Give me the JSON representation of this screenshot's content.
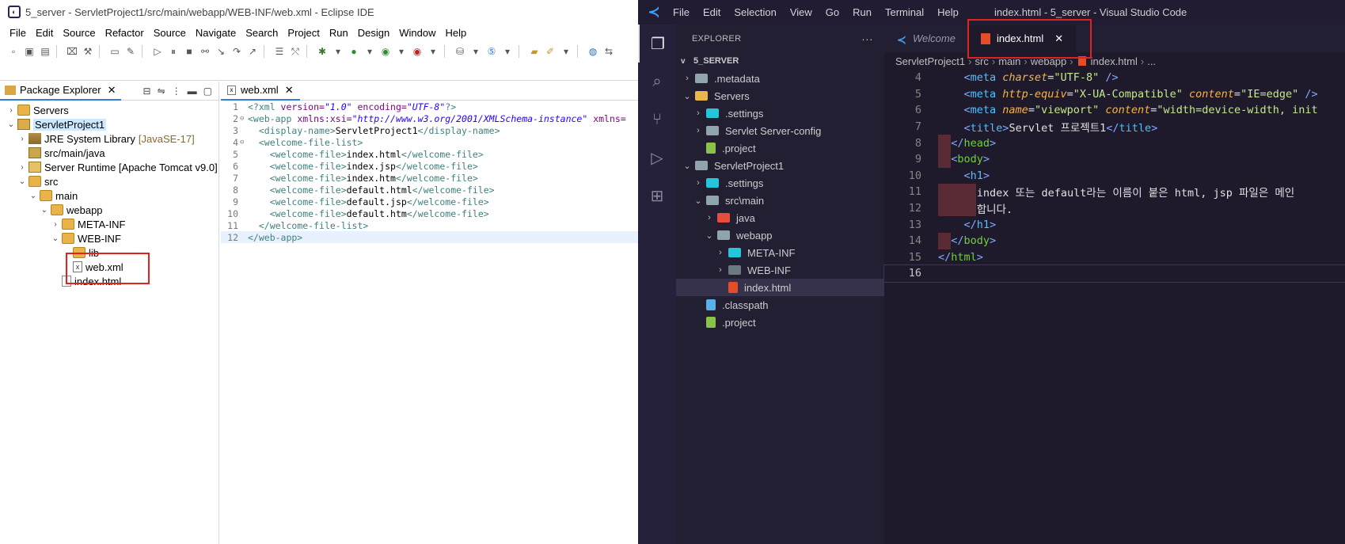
{
  "eclipse": {
    "title": "5_server - ServletProject1/src/main/webapp/WEB-INF/web.xml - Eclipse IDE",
    "menu": [
      "File",
      "Edit",
      "Source",
      "Refactor",
      "Source",
      "Navigate",
      "Search",
      "Project",
      "Run",
      "Design",
      "Window",
      "Help"
    ],
    "package_explorer": {
      "tab_label": "Package Explorer",
      "tree": [
        {
          "label": "Servers",
          "depth": 0,
          "twisty": ">",
          "icon": "folder"
        },
        {
          "label": "ServletProject1",
          "depth": 0,
          "twisty": "v",
          "icon": "project",
          "selected": true
        },
        {
          "label": "JRE System Library",
          "suffix": "[JavaSE-17]",
          "depth": 1,
          "twisty": ">",
          "icon": "jar"
        },
        {
          "label": "src/main/java",
          "depth": 1,
          "twisty": "",
          "icon": "package"
        },
        {
          "label": "Server Runtime [Apache Tomcat v9.0]",
          "depth": 1,
          "twisty": ">",
          "icon": "server"
        },
        {
          "label": "src",
          "depth": 1,
          "twisty": "v",
          "icon": "folder"
        },
        {
          "label": "main",
          "depth": 2,
          "twisty": "v",
          "icon": "folder"
        },
        {
          "label": "webapp",
          "depth": 3,
          "twisty": "v",
          "icon": "folder"
        },
        {
          "label": "META-INF",
          "depth": 4,
          "twisty": ">",
          "icon": "folder"
        },
        {
          "label": "WEB-INF",
          "depth": 4,
          "twisty": "v",
          "icon": "folder"
        },
        {
          "label": "lib",
          "depth": 5,
          "twisty": "",
          "icon": "folder"
        },
        {
          "label": "web.xml",
          "depth": 5,
          "twisty": "",
          "icon": "xml"
        },
        {
          "label": "index.html",
          "depth": 4,
          "twisty": "",
          "icon": "file"
        }
      ]
    },
    "editor": {
      "tab_label": "web.xml",
      "lines": [
        {
          "n": "1",
          "fold": "",
          "tokens": [
            [
              "x-tag",
              "<?xml "
            ],
            [
              "x-attr",
              "version="
            ],
            [
              "x-val",
              "\"1.0\""
            ],
            [
              "x-attr",
              " encoding="
            ],
            [
              "x-val",
              "\"UTF-8\""
            ],
            [
              "x-tag",
              "?>"
            ]
          ]
        },
        {
          "n": "2",
          "fold": "⊖",
          "tokens": [
            [
              "x-tag",
              "<web-app "
            ],
            [
              "x-attr",
              "xmlns:xsi="
            ],
            [
              "x-val",
              "\"http://www.w3.org/2001/XMLSchema-instance\""
            ],
            [
              "x-attr",
              " xmlns="
            ]
          ]
        },
        {
          "n": "3",
          "fold": "",
          "tokens": [
            [
              "x-txt",
              "  "
            ],
            [
              "x-tag",
              "<display-name>"
            ],
            [
              "x-txt",
              "ServletProject1"
            ],
            [
              "x-tag",
              "</display-name>"
            ]
          ]
        },
        {
          "n": "4",
          "fold": "⊖",
          "tokens": [
            [
              "x-txt",
              "  "
            ],
            [
              "x-tag",
              "<welcome-file-list>"
            ]
          ]
        },
        {
          "n": "5",
          "fold": "",
          "tokens": [
            [
              "x-txt",
              "    "
            ],
            [
              "x-tag",
              "<welcome-file>"
            ],
            [
              "x-txt",
              "index.html"
            ],
            [
              "x-tag",
              "</welcome-file>"
            ]
          ]
        },
        {
          "n": "6",
          "fold": "",
          "tokens": [
            [
              "x-txt",
              "    "
            ],
            [
              "x-tag",
              "<welcome-file>"
            ],
            [
              "x-txt",
              "index.jsp"
            ],
            [
              "x-tag",
              "</welcome-file>"
            ]
          ]
        },
        {
          "n": "7",
          "fold": "",
          "tokens": [
            [
              "x-txt",
              "    "
            ],
            [
              "x-tag",
              "<welcome-file>"
            ],
            [
              "x-txt",
              "index.htm"
            ],
            [
              "x-tag",
              "</welcome-file>"
            ]
          ]
        },
        {
          "n": "8",
          "fold": "",
          "tokens": [
            [
              "x-txt",
              "    "
            ],
            [
              "x-tag",
              "<welcome-file>"
            ],
            [
              "x-txt",
              "default.html"
            ],
            [
              "x-tag",
              "</welcome-file>"
            ]
          ]
        },
        {
          "n": "9",
          "fold": "",
          "tokens": [
            [
              "x-txt",
              "    "
            ],
            [
              "x-tag",
              "<welcome-file>"
            ],
            [
              "x-txt",
              "default.jsp"
            ],
            [
              "x-tag",
              "</welcome-file>"
            ]
          ]
        },
        {
          "n": "10",
          "fold": "",
          "tokens": [
            [
              "x-txt",
              "    "
            ],
            [
              "x-tag",
              "<welcome-file>"
            ],
            [
              "x-txt",
              "default.htm"
            ],
            [
              "x-tag",
              "</welcome-file>"
            ]
          ]
        },
        {
          "n": "11",
          "fold": "",
          "tokens": [
            [
              "x-txt",
              "  "
            ],
            [
              "x-tag",
              "</welcome-file-list>"
            ]
          ]
        },
        {
          "n": "12",
          "fold": "",
          "tokens": [
            [
              "x-tag",
              "</web-app>"
            ]
          ],
          "current": true
        }
      ]
    }
  },
  "vscode": {
    "window_title": "index.html - 5_server - Visual Studio Code",
    "menu": [
      "File",
      "Edit",
      "Selection",
      "View",
      "Go",
      "Run",
      "Terminal",
      "Help"
    ],
    "explorer": {
      "header": "EXPLORER",
      "more": "···",
      "root": "5_SERVER",
      "items": [
        {
          "label": ".metadata",
          "depth": 1,
          "chev": ">",
          "icon": "vf-grey"
        },
        {
          "label": "Servers",
          "depth": 1,
          "chev": "v",
          "icon": "vf-yellow"
        },
        {
          "label": ".settings",
          "depth": 2,
          "chev": ">",
          "icon": "vf-teal"
        },
        {
          "label": "Servlet Server-config",
          "depth": 2,
          "chev": ">",
          "icon": "vf-grey"
        },
        {
          "label": ".project",
          "depth": 2,
          "chev": "",
          "icon": "vfile-green"
        },
        {
          "label": "ServletProject1",
          "depth": 1,
          "chev": "v",
          "icon": "vf-grey"
        },
        {
          "label": ".settings",
          "depth": 2,
          "chev": ">",
          "icon": "vf-teal"
        },
        {
          "label": "src\\main",
          "depth": 2,
          "chev": "v",
          "icon": "vf-grey"
        },
        {
          "label": "java",
          "depth": 3,
          "chev": ">",
          "icon": "vf-red"
        },
        {
          "label": "webapp",
          "depth": 3,
          "chev": "v",
          "icon": "vf-grey"
        },
        {
          "label": "META-INF",
          "depth": 4,
          "chev": ">",
          "icon": "vf-teal"
        },
        {
          "label": "WEB-INF",
          "depth": 4,
          "chev": ">",
          "icon": "vf-dark"
        },
        {
          "label": "index.html",
          "depth": 4,
          "chev": "",
          "icon": "vfile-html",
          "selected": true
        },
        {
          "label": ".classpath",
          "depth": 2,
          "chev": "",
          "icon": "vfile-gen"
        },
        {
          "label": ".project",
          "depth": 2,
          "chev": "",
          "icon": "vfile-green"
        }
      ]
    },
    "tabs": [
      {
        "label": "Welcome",
        "icon": "vscode",
        "active": false
      },
      {
        "label": "index.html",
        "icon": "html",
        "active": true,
        "close": "✕"
      }
    ],
    "breadcrumb": [
      "ServletProject1",
      "src",
      "main",
      "webapp",
      "index.html",
      "..."
    ],
    "code": [
      {
        "n": "4",
        "tokens": [
          [
            "",
            "    "
          ],
          [
            "h-bracket",
            "<"
          ],
          [
            "h-tag2",
            "meta "
          ],
          [
            "h-attr",
            "charset"
          ],
          [
            "",
            "="
          ],
          [
            "h-str",
            "\"UTF-8\""
          ],
          [
            "h-bracket",
            " />"
          ]
        ]
      },
      {
        "n": "5",
        "tokens": [
          [
            "",
            "    "
          ],
          [
            "h-bracket",
            "<"
          ],
          [
            "h-tag2",
            "meta "
          ],
          [
            "h-attr",
            "http-equiv"
          ],
          [
            "",
            "="
          ],
          [
            "h-str",
            "\"X-UA-Compatible\""
          ],
          [
            "h-attr",
            " content"
          ],
          [
            "",
            "="
          ],
          [
            "h-str",
            "\"IE=edge\""
          ],
          [
            "h-bracket",
            " />"
          ]
        ]
      },
      {
        "n": "6",
        "tokens": [
          [
            "",
            "    "
          ],
          [
            "h-bracket",
            "<"
          ],
          [
            "h-tag2",
            "meta "
          ],
          [
            "h-attr",
            "name"
          ],
          [
            "",
            "="
          ],
          [
            "h-str",
            "\"viewport\""
          ],
          [
            "h-attr",
            " content"
          ],
          [
            "",
            "="
          ],
          [
            "h-str",
            "\"width=device-width, init"
          ]
        ]
      },
      {
        "n": "7",
        "tokens": [
          [
            "",
            "    "
          ],
          [
            "h-bracket",
            "<"
          ],
          [
            "h-tag2",
            "title"
          ],
          [
            "h-bracket",
            ">"
          ],
          [
            "",
            "Servlet 프로젝트1"
          ],
          [
            "h-bracket",
            "</"
          ],
          [
            "h-tag2",
            "title"
          ],
          [
            "h-bracket",
            ">"
          ]
        ]
      },
      {
        "n": "8",
        "tokens": [
          [
            "",
            "  "
          ],
          [
            "h-bracket",
            "</"
          ],
          [
            "h-tag",
            "head"
          ],
          [
            "h-bracket",
            ">"
          ]
        ],
        "mark": "short"
      },
      {
        "n": "9",
        "tokens": [
          [
            "",
            "  "
          ],
          [
            "h-bracket",
            "<"
          ],
          [
            "h-tag",
            "body"
          ],
          [
            "h-bracket",
            ">"
          ]
        ],
        "mark": "short"
      },
      {
        "n": "10",
        "tokens": [
          [
            "",
            "    "
          ],
          [
            "h-bracket",
            "<"
          ],
          [
            "h-tag2",
            "h1"
          ],
          [
            "h-bracket",
            ">"
          ]
        ]
      },
      {
        "n": "11",
        "tokens": [
          [
            "",
            "      index 또는 default라는 이름이 붙은 html, jsp 파일은 메인"
          ]
        ],
        "mark": "long"
      },
      {
        "n": "12",
        "tokens": [
          [
            "",
            "      합니다."
          ]
        ],
        "mark": "long"
      },
      {
        "n": "13",
        "tokens": [
          [
            "",
            "    "
          ],
          [
            "h-bracket",
            "</"
          ],
          [
            "h-tag2",
            "h1"
          ],
          [
            "h-bracket",
            ">"
          ]
        ]
      },
      {
        "n": "14",
        "tokens": [
          [
            "",
            "  "
          ],
          [
            "h-bracket",
            "</"
          ],
          [
            "h-tag",
            "body"
          ],
          [
            "h-bracket",
            ">"
          ]
        ],
        "mark": "short"
      },
      {
        "n": "15",
        "tokens": [
          [
            "h-bracket",
            "</"
          ],
          [
            "h-tag",
            "html"
          ],
          [
            "h-bracket",
            ">"
          ]
        ]
      },
      {
        "n": "16",
        "tokens": [
          [
            "",
            ""
          ]
        ],
        "current": true
      }
    ]
  }
}
